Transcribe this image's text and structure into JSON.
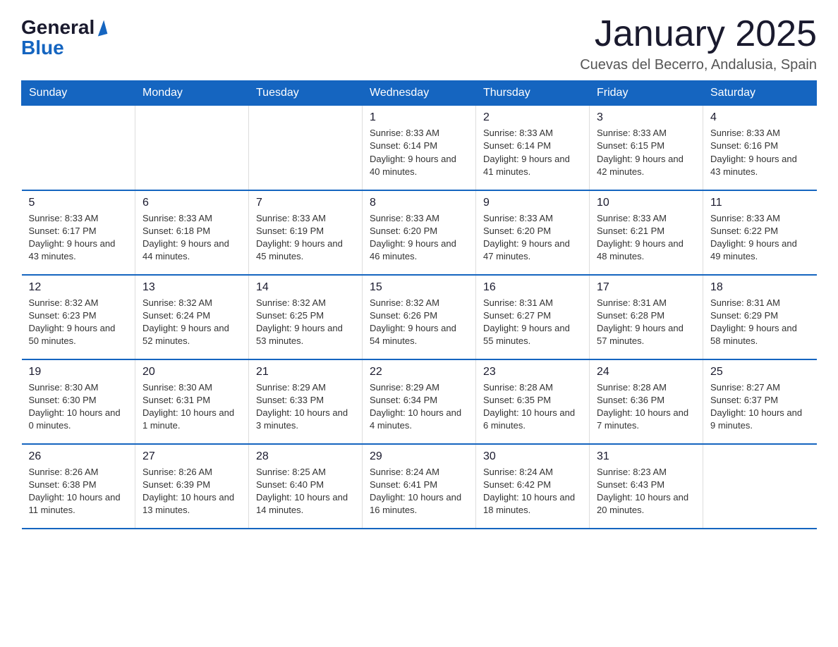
{
  "header": {
    "logo_general": "General",
    "logo_blue": "Blue",
    "title": "January 2025",
    "location": "Cuevas del Becerro, Andalusia, Spain"
  },
  "days_of_week": [
    "Sunday",
    "Monday",
    "Tuesday",
    "Wednesday",
    "Thursday",
    "Friday",
    "Saturday"
  ],
  "weeks": [
    [
      {
        "day": "",
        "info": ""
      },
      {
        "day": "",
        "info": ""
      },
      {
        "day": "",
        "info": ""
      },
      {
        "day": "1",
        "info": "Sunrise: 8:33 AM\nSunset: 6:14 PM\nDaylight: 9 hours and 40 minutes."
      },
      {
        "day": "2",
        "info": "Sunrise: 8:33 AM\nSunset: 6:14 PM\nDaylight: 9 hours and 41 minutes."
      },
      {
        "day": "3",
        "info": "Sunrise: 8:33 AM\nSunset: 6:15 PM\nDaylight: 9 hours and 42 minutes."
      },
      {
        "day": "4",
        "info": "Sunrise: 8:33 AM\nSunset: 6:16 PM\nDaylight: 9 hours and 43 minutes."
      }
    ],
    [
      {
        "day": "5",
        "info": "Sunrise: 8:33 AM\nSunset: 6:17 PM\nDaylight: 9 hours and 43 minutes."
      },
      {
        "day": "6",
        "info": "Sunrise: 8:33 AM\nSunset: 6:18 PM\nDaylight: 9 hours and 44 minutes."
      },
      {
        "day": "7",
        "info": "Sunrise: 8:33 AM\nSunset: 6:19 PM\nDaylight: 9 hours and 45 minutes."
      },
      {
        "day": "8",
        "info": "Sunrise: 8:33 AM\nSunset: 6:20 PM\nDaylight: 9 hours and 46 minutes."
      },
      {
        "day": "9",
        "info": "Sunrise: 8:33 AM\nSunset: 6:20 PM\nDaylight: 9 hours and 47 minutes."
      },
      {
        "day": "10",
        "info": "Sunrise: 8:33 AM\nSunset: 6:21 PM\nDaylight: 9 hours and 48 minutes."
      },
      {
        "day": "11",
        "info": "Sunrise: 8:33 AM\nSunset: 6:22 PM\nDaylight: 9 hours and 49 minutes."
      }
    ],
    [
      {
        "day": "12",
        "info": "Sunrise: 8:32 AM\nSunset: 6:23 PM\nDaylight: 9 hours and 50 minutes."
      },
      {
        "day": "13",
        "info": "Sunrise: 8:32 AM\nSunset: 6:24 PM\nDaylight: 9 hours and 52 minutes."
      },
      {
        "day": "14",
        "info": "Sunrise: 8:32 AM\nSunset: 6:25 PM\nDaylight: 9 hours and 53 minutes."
      },
      {
        "day": "15",
        "info": "Sunrise: 8:32 AM\nSunset: 6:26 PM\nDaylight: 9 hours and 54 minutes."
      },
      {
        "day": "16",
        "info": "Sunrise: 8:31 AM\nSunset: 6:27 PM\nDaylight: 9 hours and 55 minutes."
      },
      {
        "day": "17",
        "info": "Sunrise: 8:31 AM\nSunset: 6:28 PM\nDaylight: 9 hours and 57 minutes."
      },
      {
        "day": "18",
        "info": "Sunrise: 8:31 AM\nSunset: 6:29 PM\nDaylight: 9 hours and 58 minutes."
      }
    ],
    [
      {
        "day": "19",
        "info": "Sunrise: 8:30 AM\nSunset: 6:30 PM\nDaylight: 10 hours and 0 minutes."
      },
      {
        "day": "20",
        "info": "Sunrise: 8:30 AM\nSunset: 6:31 PM\nDaylight: 10 hours and 1 minute."
      },
      {
        "day": "21",
        "info": "Sunrise: 8:29 AM\nSunset: 6:33 PM\nDaylight: 10 hours and 3 minutes."
      },
      {
        "day": "22",
        "info": "Sunrise: 8:29 AM\nSunset: 6:34 PM\nDaylight: 10 hours and 4 minutes."
      },
      {
        "day": "23",
        "info": "Sunrise: 8:28 AM\nSunset: 6:35 PM\nDaylight: 10 hours and 6 minutes."
      },
      {
        "day": "24",
        "info": "Sunrise: 8:28 AM\nSunset: 6:36 PM\nDaylight: 10 hours and 7 minutes."
      },
      {
        "day": "25",
        "info": "Sunrise: 8:27 AM\nSunset: 6:37 PM\nDaylight: 10 hours and 9 minutes."
      }
    ],
    [
      {
        "day": "26",
        "info": "Sunrise: 8:26 AM\nSunset: 6:38 PM\nDaylight: 10 hours and 11 minutes."
      },
      {
        "day": "27",
        "info": "Sunrise: 8:26 AM\nSunset: 6:39 PM\nDaylight: 10 hours and 13 minutes."
      },
      {
        "day": "28",
        "info": "Sunrise: 8:25 AM\nSunset: 6:40 PM\nDaylight: 10 hours and 14 minutes."
      },
      {
        "day": "29",
        "info": "Sunrise: 8:24 AM\nSunset: 6:41 PM\nDaylight: 10 hours and 16 minutes."
      },
      {
        "day": "30",
        "info": "Sunrise: 8:24 AM\nSunset: 6:42 PM\nDaylight: 10 hours and 18 minutes."
      },
      {
        "day": "31",
        "info": "Sunrise: 8:23 AM\nSunset: 6:43 PM\nDaylight: 10 hours and 20 minutes."
      },
      {
        "day": "",
        "info": ""
      }
    ]
  ]
}
